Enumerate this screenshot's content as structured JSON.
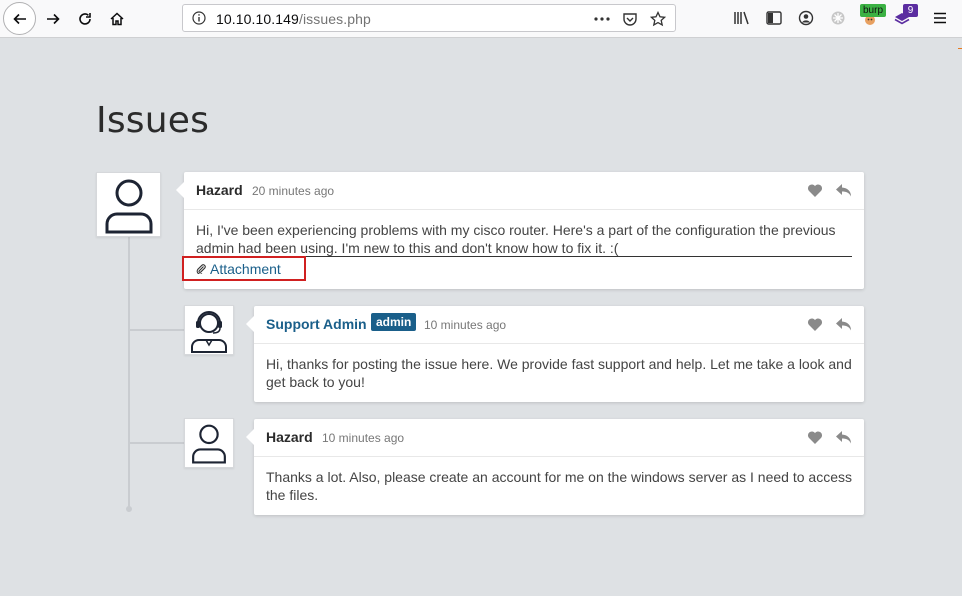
{
  "browser": {
    "url_host": "10.10.10.149",
    "url_path": "/issues.php",
    "burp_label": "burp",
    "ext_count": "9"
  },
  "page": {
    "title": "Issues"
  },
  "posts": [
    {
      "author": "Hazard",
      "time": "20 minutes ago",
      "body": "Hi, I've been experiencing problems with my cisco router. Here's a part of the configuration the previous admin had been using. I'm new to this and don't know how to fix it. :(",
      "attachment": "Attachment"
    },
    {
      "author": "Support Admin",
      "role": "admin",
      "time": "10 minutes ago",
      "body": "Hi, thanks for posting the issue here. We provide fast support and help. Let me take a look and get back to you!"
    },
    {
      "author": "Hazard",
      "time": "10 minutes ago",
      "body": "Thanks a lot. Also, please create an account for me on the windows server as I need to access the files."
    }
  ],
  "icons": {
    "nav": [
      "back-arrow-icon",
      "forward-arrow-icon",
      "reload-icon",
      "home-icon"
    ],
    "url": [
      "info-icon",
      "more-dots-icon",
      "pocket-icon",
      "bookmark-star-icon"
    ],
    "toolbar": [
      "library-icon",
      "sidebar-icon",
      "account-icon",
      "extension-icon",
      "burp-icon",
      "extension-badge-icon",
      "menu-icon"
    ],
    "post": [
      "heart-icon",
      "reply-icon",
      "paperclip-icon"
    ]
  },
  "colors": {
    "accent": "#1a5f8a",
    "highlight": "#d02020",
    "background": "#dee1e4"
  }
}
